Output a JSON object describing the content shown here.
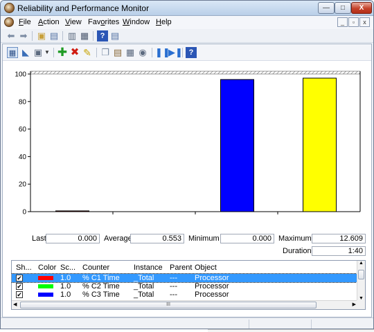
{
  "window": {
    "title": "Reliability and Performance Monitor"
  },
  "menu": {
    "items": [
      {
        "label": "File",
        "accel": "F"
      },
      {
        "label": "Action",
        "accel": "A"
      },
      {
        "label": "View",
        "accel": "V"
      },
      {
        "label": "Favorites",
        "accel": "o"
      },
      {
        "label": "Window",
        "accel": "W"
      },
      {
        "label": "Help",
        "accel": "H"
      }
    ]
  },
  "toolbar1": {
    "icons": [
      "back-arrow-icon",
      "forward-arrow-icon",
      "up-folder-icon",
      "show-hide-tree-icon",
      "properties-icon",
      "print-icon",
      "help-icon",
      "console-view-icon"
    ]
  },
  "toolbar2": {
    "icons": [
      "view-graph-icon",
      "view-histogram-icon",
      "change-graph-type-icon",
      "dropdown-arrow-icon",
      "add-counter-icon",
      "delete-counter-icon",
      "highlight-icon",
      "copy-icon",
      "paste-icon",
      "properties-icon",
      "zoom-icon",
      "freeze-display-icon",
      "update-data-icon",
      "help-icon"
    ]
  },
  "chart_data": {
    "type": "bar",
    "ylim": [
      0,
      100
    ],
    "yticks": [
      "0",
      "20",
      "40",
      "60",
      "80",
      "100"
    ],
    "series": [
      {
        "name": "% C1 Time",
        "color": "#ff0000",
        "value": 0.553
      },
      {
        "name": "% C2 Time",
        "color": "#00ff00",
        "value": 0
      },
      {
        "name": "% C3 Time",
        "color": "#0000ff",
        "value": 96
      },
      {
        "name": "",
        "color": "#ffff00",
        "value": 97
      }
    ]
  },
  "stats": {
    "last_label": "Last",
    "last_value": "0.000",
    "average_label": "Average",
    "average_value": "0.553",
    "minimum_label": "Minimum",
    "minimum_value": "0.000",
    "maximum_label": "Maximum",
    "maximum_value": "12.609",
    "duration_label": "Duration",
    "duration_value": "1:40"
  },
  "legend": {
    "headers": [
      "Sh...",
      "Color",
      "Sc...",
      "Counter",
      "Instance",
      "Parent",
      "Object"
    ],
    "rows": [
      {
        "show": "✔",
        "color": "#ff0000",
        "scale": "1.0",
        "counter": "% C1 Time",
        "instance": "_Total",
        "parent": "---",
        "object": "Processor",
        "selected": true
      },
      {
        "show": "✔",
        "color": "#00ff00",
        "scale": "1.0",
        "counter": "% C2 Time",
        "instance": "_Total",
        "parent": "---",
        "object": "Processor",
        "selected": false
      },
      {
        "show": "✔",
        "color": "#0000ff",
        "scale": "1.0",
        "counter": "% C3 Time",
        "instance": "_Total",
        "parent": "---",
        "object": "Processor",
        "selected": false
      }
    ],
    "hscroll_grip": "III"
  },
  "window_buttons": {
    "minimize": "—",
    "maximize": "□",
    "close": "X"
  },
  "mdi_buttons": {
    "minimize": "_",
    "restore": "▫",
    "close": "x"
  }
}
